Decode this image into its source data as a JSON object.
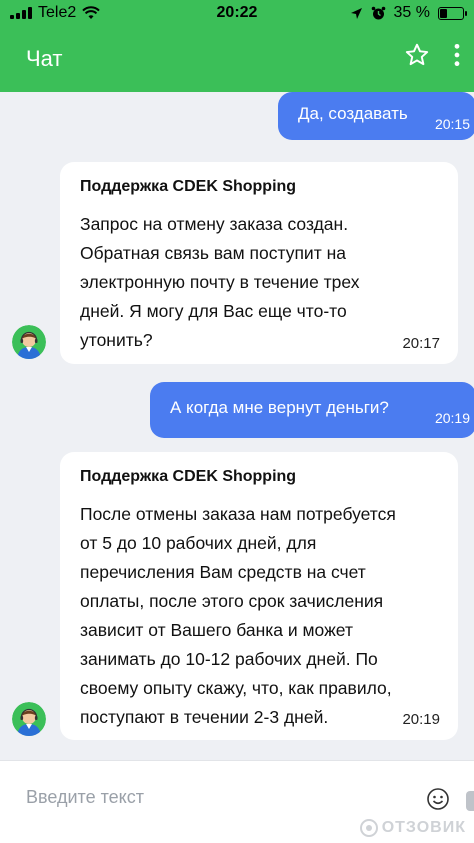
{
  "status_bar": {
    "carrier": "Tele2",
    "time": "20:22",
    "battery": "35 %",
    "battery_level": 0.35
  },
  "header": {
    "title": "Чат",
    "star_icon": "star-icon",
    "more_icon": "more-icon"
  },
  "messages": [
    {
      "direction": "out",
      "text": "Да, создавать",
      "time": "20:15"
    },
    {
      "direction": "in",
      "sender": "Поддержка CDEK Shopping",
      "text": "Запрос на отмену заказа создан.\nОбратная связь вам поступит на\nэлектронную почту в течение трех\nдней. Я могу для Вас еще что-то\nутонить?",
      "time": "20:17"
    },
    {
      "direction": "out",
      "text": "А когда мне вернут деньги?",
      "time": "20:19"
    },
    {
      "direction": "in",
      "sender": "Поддержка CDEK Shopping",
      "text": "После отмены заказа нам потребуется\nот 5 до 10 рабочих дней, для\nперечисления Вам средств на счет\nоплаты, после этого срок зачисления\nзависит от Вашего банка и может\nзанимать до 10-12 рабочих дней. По\nсвоему опыту скажу, что, как правило,\nпоступают в течении 2-3 дней.",
      "time": "20:19"
    }
  ],
  "input": {
    "placeholder": "Введите текст"
  },
  "watermark": "ОТЗОВИК",
  "colors": {
    "brand_green": "#3bbf58",
    "outgoing_bubble": "#4b7cf0",
    "background": "#eef0f4"
  }
}
